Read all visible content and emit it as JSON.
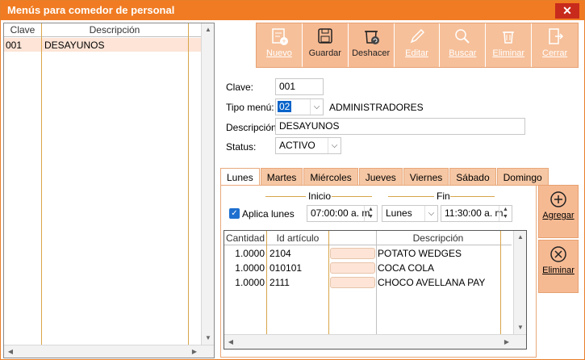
{
  "window": {
    "title": "Menús para comedor de personal",
    "close_glyph": "✕"
  },
  "left_list": {
    "columns": [
      "Clave",
      "Descripción"
    ],
    "rows": [
      {
        "clave": "001",
        "descripcion": "DESAYUNOS"
      }
    ]
  },
  "toolbar": {
    "buttons": [
      {
        "label": "Nuevo",
        "icon": "new-document-icon",
        "enabled": false
      },
      {
        "label": "Guardar",
        "icon": "save-icon",
        "enabled": true
      },
      {
        "label": "Deshacer",
        "icon": "undo-icon",
        "enabled": true
      },
      {
        "label": "Editar",
        "icon": "pencil-icon",
        "enabled": false
      },
      {
        "label": "Buscar",
        "icon": "search-icon",
        "enabled": false
      },
      {
        "label": "Eliminar",
        "icon": "trash-icon",
        "enabled": false
      },
      {
        "label": "Cerrar",
        "icon": "exit-icon",
        "enabled": false
      }
    ]
  },
  "form": {
    "clave_label": "Clave:",
    "clave_value": "001",
    "tipo_label": "Tipo menú:",
    "tipo_value": "02",
    "tipo_desc": "ADMINISTRADORES",
    "descripcion_label": "Descripción:",
    "descripcion_value": "DESAYUNOS",
    "status_label": "Status:",
    "status_value": "ACTIVO"
  },
  "tabs": [
    "Lunes",
    "Martes",
    "Miércoles",
    "Jueves",
    "Viernes",
    "Sábado",
    "Domingo"
  ],
  "active_tab": "Lunes",
  "schedule": {
    "inicio_label": "Inicio",
    "fin_label": "Fin",
    "aplica_label": "Aplica lunes",
    "aplica_checked": true,
    "inicio_time": "07:00:00 a. m.",
    "fin_day": "Lunes",
    "fin_time": "11:30:00 a. m."
  },
  "items_grid": {
    "columns": [
      "Cantidad",
      "Id artículo",
      "",
      "Descripción"
    ],
    "rows": [
      {
        "cantidad": "1.0000",
        "id": "2104",
        "descripcion": "POTATO WEDGES"
      },
      {
        "cantidad": "1.0000",
        "id": "010101",
        "descripcion": "COCA COLA"
      },
      {
        "cantidad": "1.0000",
        "id": "2111",
        "descripcion": "CHOCO AVELLANA PAY"
      }
    ]
  },
  "side_buttons": {
    "agregar": "Agregar",
    "eliminar": "Eliminar"
  },
  "colors": {
    "accent": "#f07b22",
    "toolbar_bg": "#f6c09a",
    "close": "#c82a1c",
    "selection": "#0a63c9"
  }
}
